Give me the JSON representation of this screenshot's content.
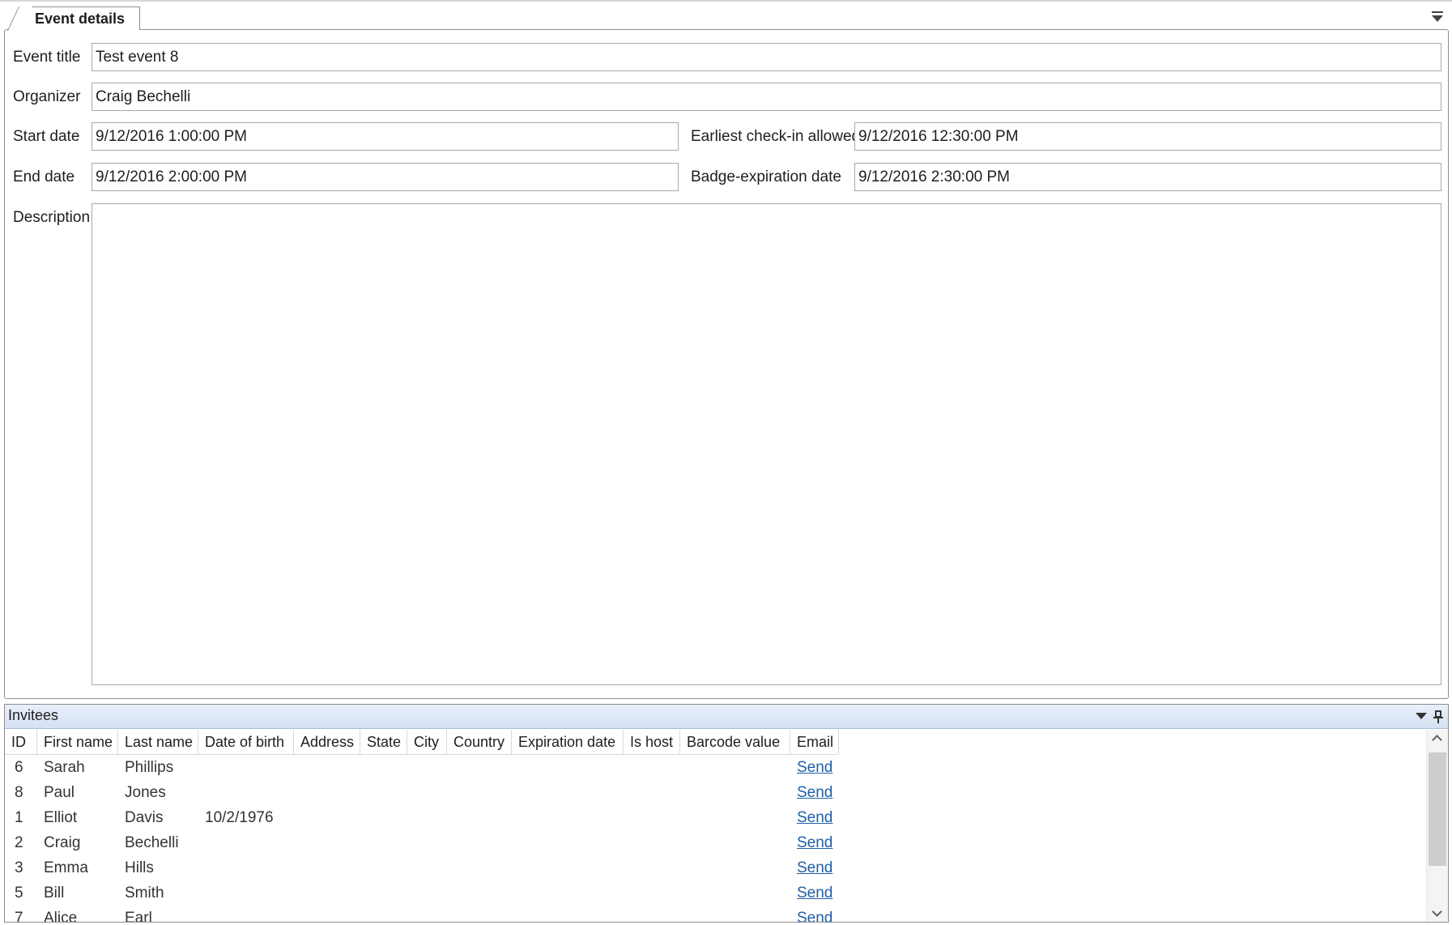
{
  "tab": {
    "label": "Event details"
  },
  "form": {
    "event_title_label": "Event title",
    "event_title_value": "Test event 8",
    "organizer_label": "Organizer",
    "organizer_value": "Craig Bechelli",
    "start_date_label": "Start date",
    "start_date_value": "9/12/2016 1:00:00 PM",
    "earliest_checkin_label": "Earliest check-in allowed",
    "earliest_checkin_value": "9/12/2016 12:30:00 PM",
    "end_date_label": "End date",
    "end_date_value": "9/12/2016 2:00:00 PM",
    "badge_expiration_label": "Badge-expiration date",
    "badge_expiration_value": "9/12/2016 2:30:00 PM",
    "description_label": "Description",
    "description_value": ""
  },
  "invitees": {
    "title": "Invitees",
    "columns": [
      "ID",
      "First name",
      "Last name",
      "Date of birth",
      "Address",
      "State",
      "City",
      "Country",
      "Expiration date",
      "Is host",
      "Barcode value",
      "Email"
    ],
    "rows": [
      {
        "id": "6",
        "first": "Sarah",
        "last": "Phillips",
        "dob": "",
        "email": "Send"
      },
      {
        "id": "8",
        "first": "Paul",
        "last": "Jones",
        "dob": "",
        "email": "Send"
      },
      {
        "id": "1",
        "first": "Elliot",
        "last": "Davis",
        "dob": "10/2/1976",
        "email": "Send"
      },
      {
        "id": "2",
        "first": "Craig",
        "last": "Bechelli",
        "dob": "",
        "email": "Send"
      },
      {
        "id": "3",
        "first": "Emma",
        "last": "Hills",
        "dob": "",
        "email": "Send"
      },
      {
        "id": "5",
        "first": "Bill",
        "last": "Smith",
        "dob": "",
        "email": "Send"
      },
      {
        "id": "7",
        "first": "Alice",
        "last": "Earl",
        "dob": "",
        "email": "Send"
      }
    ]
  }
}
